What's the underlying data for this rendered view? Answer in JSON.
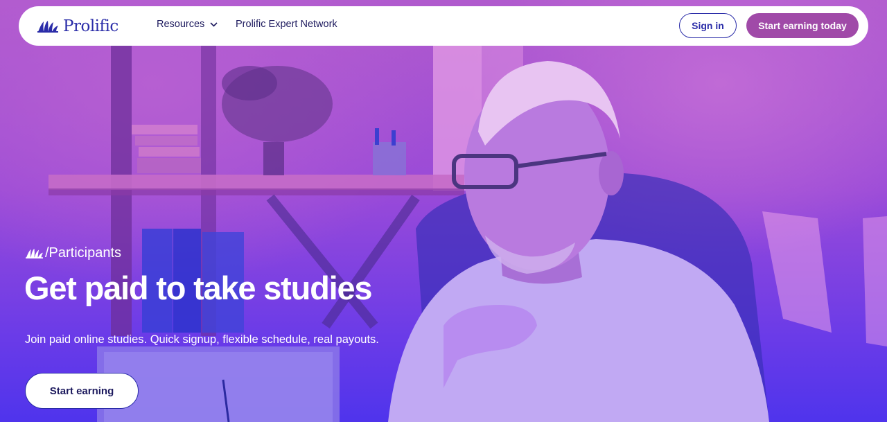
{
  "nav": {
    "brand": "Prolific",
    "items": [
      {
        "label": "Resources",
        "has_dropdown": true
      },
      {
        "label": "Prolific Expert Network",
        "has_dropdown": false
      }
    ],
    "sign_in_label": "Sign in",
    "cta_label": "Start earning today"
  },
  "hero": {
    "eyebrow": "/Participants",
    "headline": "Get paid to take studies",
    "subheadline": "Join paid online studies. Quick signup, flexible schedule, real payouts.",
    "cta_label": "Start earning"
  },
  "colors": {
    "brand_blue": "#2a2ca8",
    "cta_purple": "#a04aa8",
    "hero_overlay_top": "#b05acd",
    "hero_overlay_bottom": "#4f34ec"
  },
  "icons": {
    "logo": "prolific-fan-logo-icon",
    "dropdown": "chevron-down-icon"
  }
}
